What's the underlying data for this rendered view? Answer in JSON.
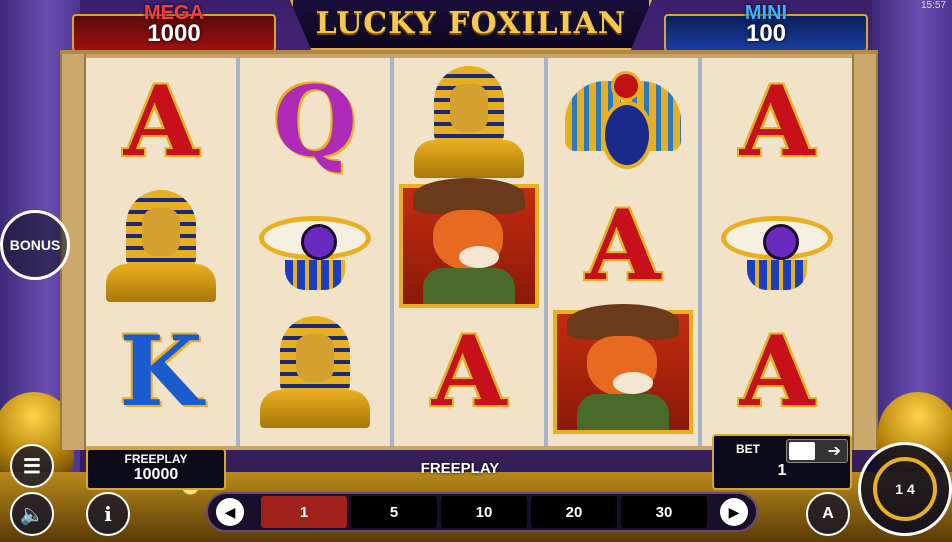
{
  "status_time": "15:57",
  "header": {
    "mega_label": "MEGA",
    "mega_value": "1000",
    "mini_label": "MINI",
    "mini_value": "100",
    "logo": "LUCKY FOXILIAN"
  },
  "side": {
    "bonus_label": "BONUS"
  },
  "reels": [
    [
      "A",
      "pharaoh",
      "K"
    ],
    [
      "Q",
      "eye-of-horus",
      "pharaoh"
    ],
    [
      "pharaoh",
      "fox",
      "A"
    ],
    [
      "scarab",
      "A",
      "fox"
    ],
    [
      "A",
      "eye-of-horus",
      "A"
    ]
  ],
  "footer": {
    "freeplay_label": "FREEPLAY",
    "freeplay_value": "10000",
    "center_message": "FREEPLAY",
    "bet_label": "BET",
    "bet_value": "1",
    "bet_options": [
      "1",
      "5",
      "10",
      "20",
      "30"
    ],
    "selected_bet": "1",
    "auto_label": "A",
    "spin_label": "1 4"
  },
  "colors": {
    "accent": "#e8b020",
    "selected_bet": "#a0201a",
    "mega": "#ff3b3b",
    "mini": "#3db4ff"
  }
}
